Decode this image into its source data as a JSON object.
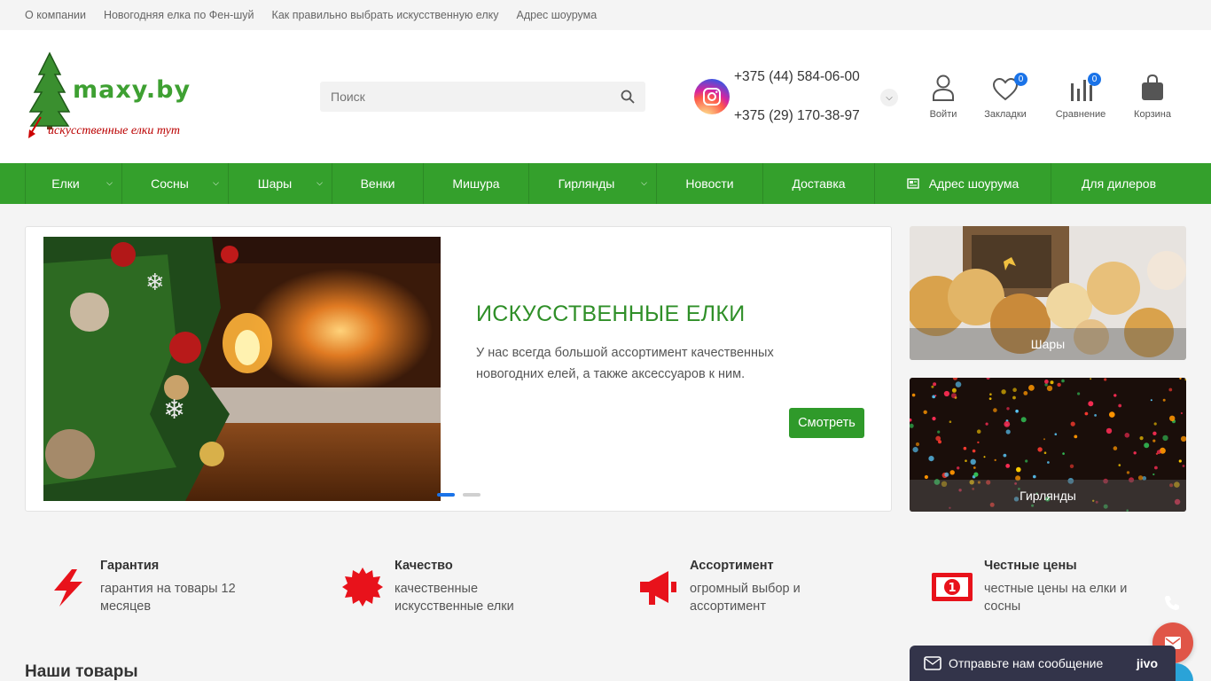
{
  "topbar": {
    "links": [
      "О компании",
      "Новогодняя елка по Фен-шуй",
      "Как правильно выбрать искусственную елку",
      "Адрес шоурума"
    ]
  },
  "header": {
    "logo_brand": "maxy.by",
    "logo_tagline": "искусственные елки тут",
    "search_placeholder": "Поиск",
    "phones": [
      "+375 (44) 584-06-00",
      "+375 (29) 170-38-97"
    ],
    "login_label": "Войти",
    "bookmarks_label": "Закладки",
    "bookmarks_count": "0",
    "compare_label": "Сравнение",
    "compare_count": "0",
    "cart_label": "Корзина"
  },
  "nav": {
    "items": [
      {
        "label": "Елки",
        "dropdown": true
      },
      {
        "label": "Сосны",
        "dropdown": true
      },
      {
        "label": "Шары",
        "dropdown": true
      },
      {
        "label": "Венки",
        "dropdown": false
      },
      {
        "label": "Мишура",
        "dropdown": false
      },
      {
        "label": "Гирлянды",
        "dropdown": true
      },
      {
        "label": "Новости",
        "dropdown": false
      },
      {
        "label": "Доставка",
        "dropdown": false
      },
      {
        "label": "Адрес шоурума",
        "dropdown": false
      },
      {
        "label": "Для дилеров",
        "dropdown": false
      }
    ]
  },
  "banner": {
    "title": "ИСКУССТВЕННЫЕ ЕЛКИ",
    "text": "У нас всегда большой ассортимент качественных новогодних елей, а также аксессуаров к ним.",
    "button": "Смотреть",
    "active_slide": 1,
    "slides_count": 2
  },
  "side_cards": [
    "Шары",
    "Гирлянды"
  ],
  "features": [
    {
      "title": "Гарантия",
      "desc": "гарантия на товары 12 месяцев",
      "icon": "lightning-icon"
    },
    {
      "title": "Качество",
      "desc": "качественные искусственные елки",
      "icon": "badge-star-icon"
    },
    {
      "title": "Ассортимент",
      "desc": "огромный выбор и ассортимент",
      "icon": "megaphone-icon"
    },
    {
      "title": "Честные цены",
      "desc": "честные цены на елки и сосны",
      "icon": "money-bill-icon"
    }
  ],
  "section_title": "Наши товары",
  "chat": {
    "label": "Отправьте нам сообщение",
    "brand": "jivo"
  },
  "colors": {
    "green": "#34a02c",
    "accent_red": "#e8121b",
    "badge_blue": "#1a73e8"
  }
}
